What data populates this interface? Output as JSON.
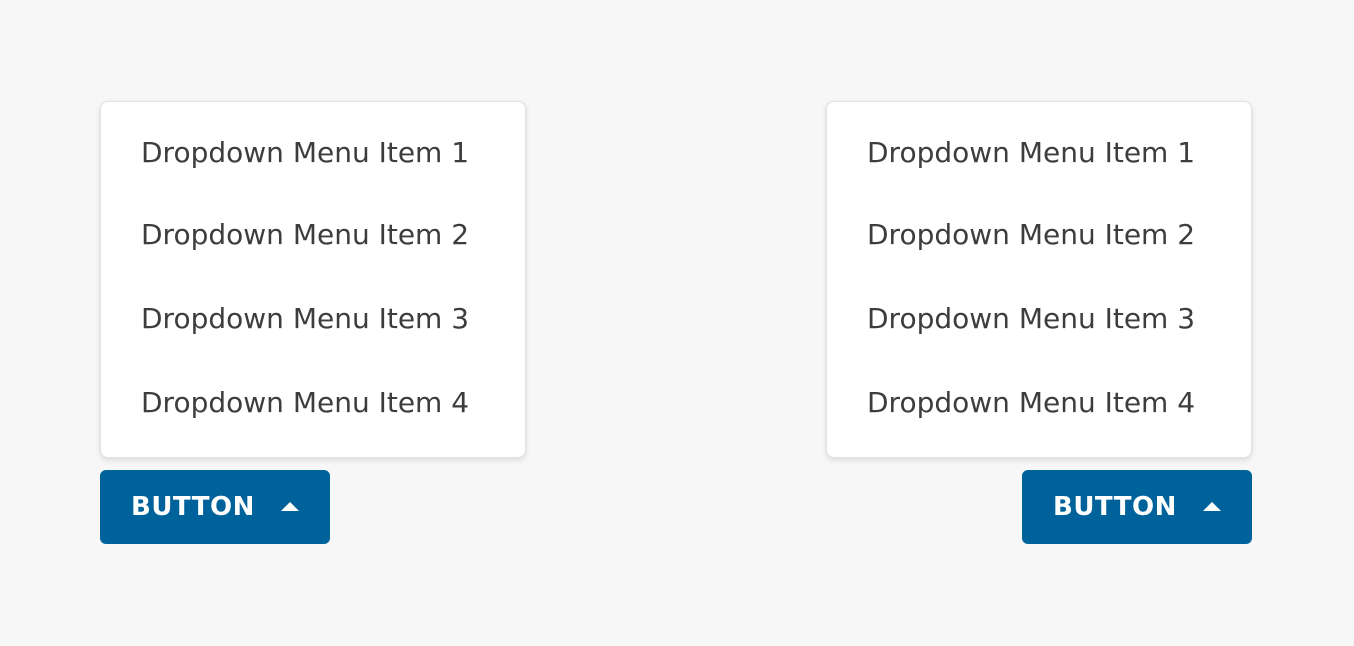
{
  "dropdowns": [
    {
      "items": [
        "Dropdown Menu Item 1",
        "Dropdown Menu Item 2",
        "Dropdown Menu Item 3",
        "Dropdown Menu Item 4"
      ],
      "button_label": "BUTTON",
      "button_icon": "caret-up-icon"
    },
    {
      "items": [
        "Dropdown Menu Item 1",
        "Dropdown Menu Item 2",
        "Dropdown Menu Item 3",
        "Dropdown Menu Item 4"
      ],
      "button_label": "BUTTON",
      "button_icon": "caret-up-icon"
    }
  ],
  "colors": {
    "background": "#f7f7f7",
    "button": "#00629b",
    "text": "#3d3d3d",
    "menu": "#ffffff"
  }
}
